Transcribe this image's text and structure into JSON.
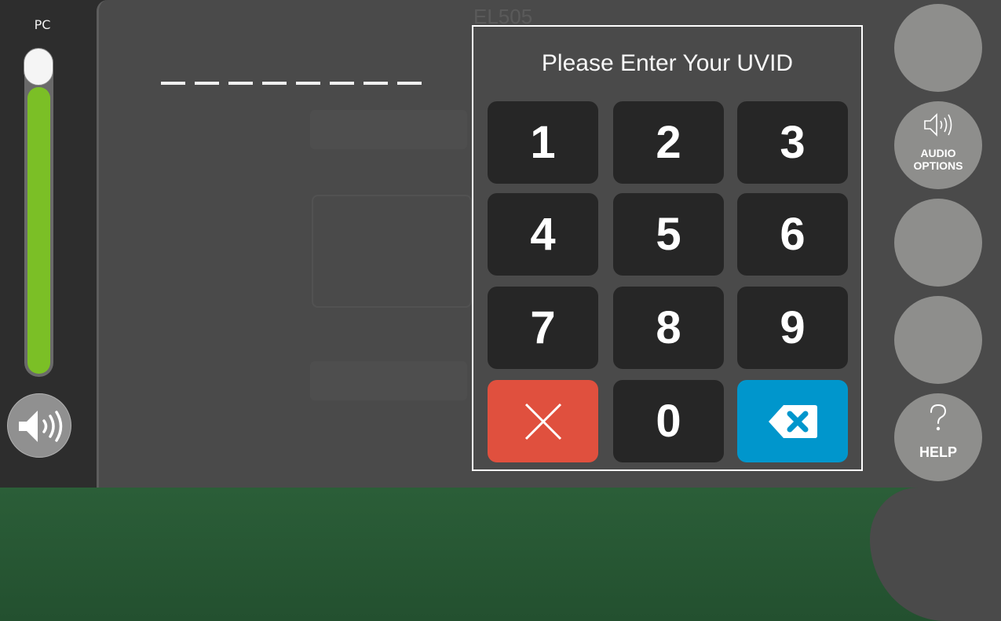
{
  "left_panel": {
    "pc_label": "PC",
    "volume_level": 0.89
  },
  "main": {
    "room_name": "EL505",
    "uvid_slot_count": 8
  },
  "keypad": {
    "title": "Please Enter Your UVID",
    "keys": [
      "1",
      "2",
      "3",
      "4",
      "5",
      "6",
      "7",
      "8",
      "9",
      "0"
    ],
    "clear_icon": "x-icon",
    "backspace_icon": "backspace-icon"
  },
  "right_panel": {
    "audio_options_line1": "AUDIO",
    "audio_options_line2": "OPTIONS",
    "help_label": "HELP",
    "audio_icon": "speaker-icon",
    "help_icon": "question-icon"
  },
  "colors": {
    "volume_fill": "#7bbf26",
    "clear_key": "#e0503e",
    "backspace_key": "#0096cc",
    "footer": "#2b5e38"
  }
}
